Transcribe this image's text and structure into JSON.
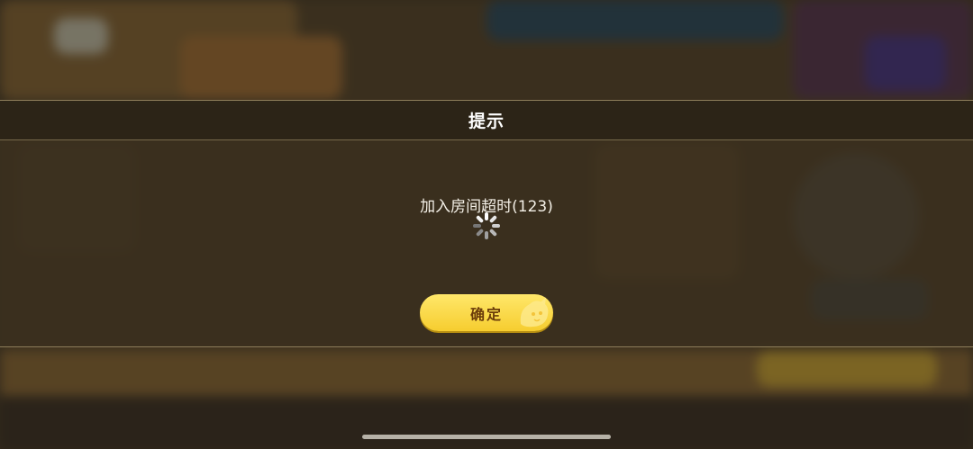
{
  "dialog": {
    "title": "提示",
    "message": "加入房间超时(123)",
    "confirm_label": "确定"
  },
  "colors": {
    "button_fill": "#f6cd2f",
    "button_text": "#6b3c0a",
    "title_text": "#ffffff",
    "message_text": "#f3efe6"
  },
  "icons": {
    "spinner": "loading-spinner-icon",
    "button_decoration": "mascot-face-icon"
  }
}
